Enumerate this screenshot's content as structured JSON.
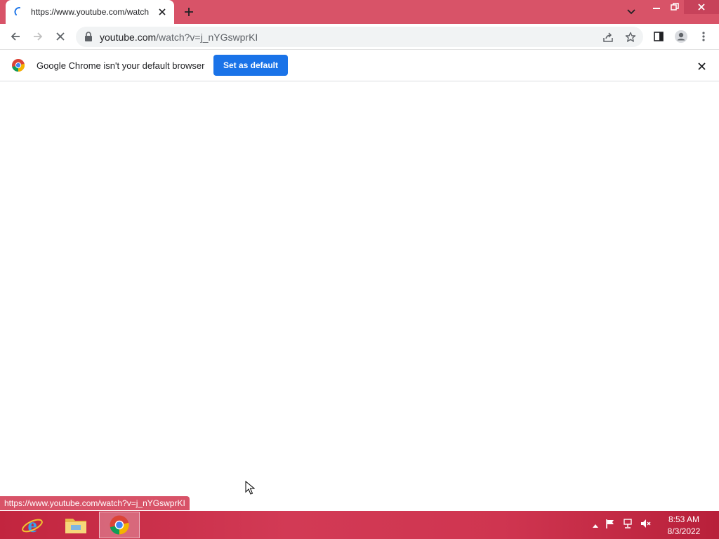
{
  "tab": {
    "title": "https://www.youtube.com/watch"
  },
  "omnibox": {
    "url_host": "youtube.com",
    "url_path": "/watch?v=j_nYGswprKI"
  },
  "infobar": {
    "message": "Google Chrome isn't your default browser",
    "button_label": "Set as default"
  },
  "status": {
    "link_url": "https://www.youtube.com/watch?v=j_nYGswprKI"
  },
  "taskbar": {
    "apps": [
      {
        "name": "internet-explorer-icon"
      },
      {
        "name": "file-explorer-icon"
      },
      {
        "name": "chrome-icon",
        "active": true
      }
    ],
    "clock": {
      "time": "8:53 AM",
      "date": "8/3/2022"
    }
  },
  "colors": {
    "accent": "#d85368",
    "taskbar": "#c2253f",
    "button": "#1a73e8"
  }
}
